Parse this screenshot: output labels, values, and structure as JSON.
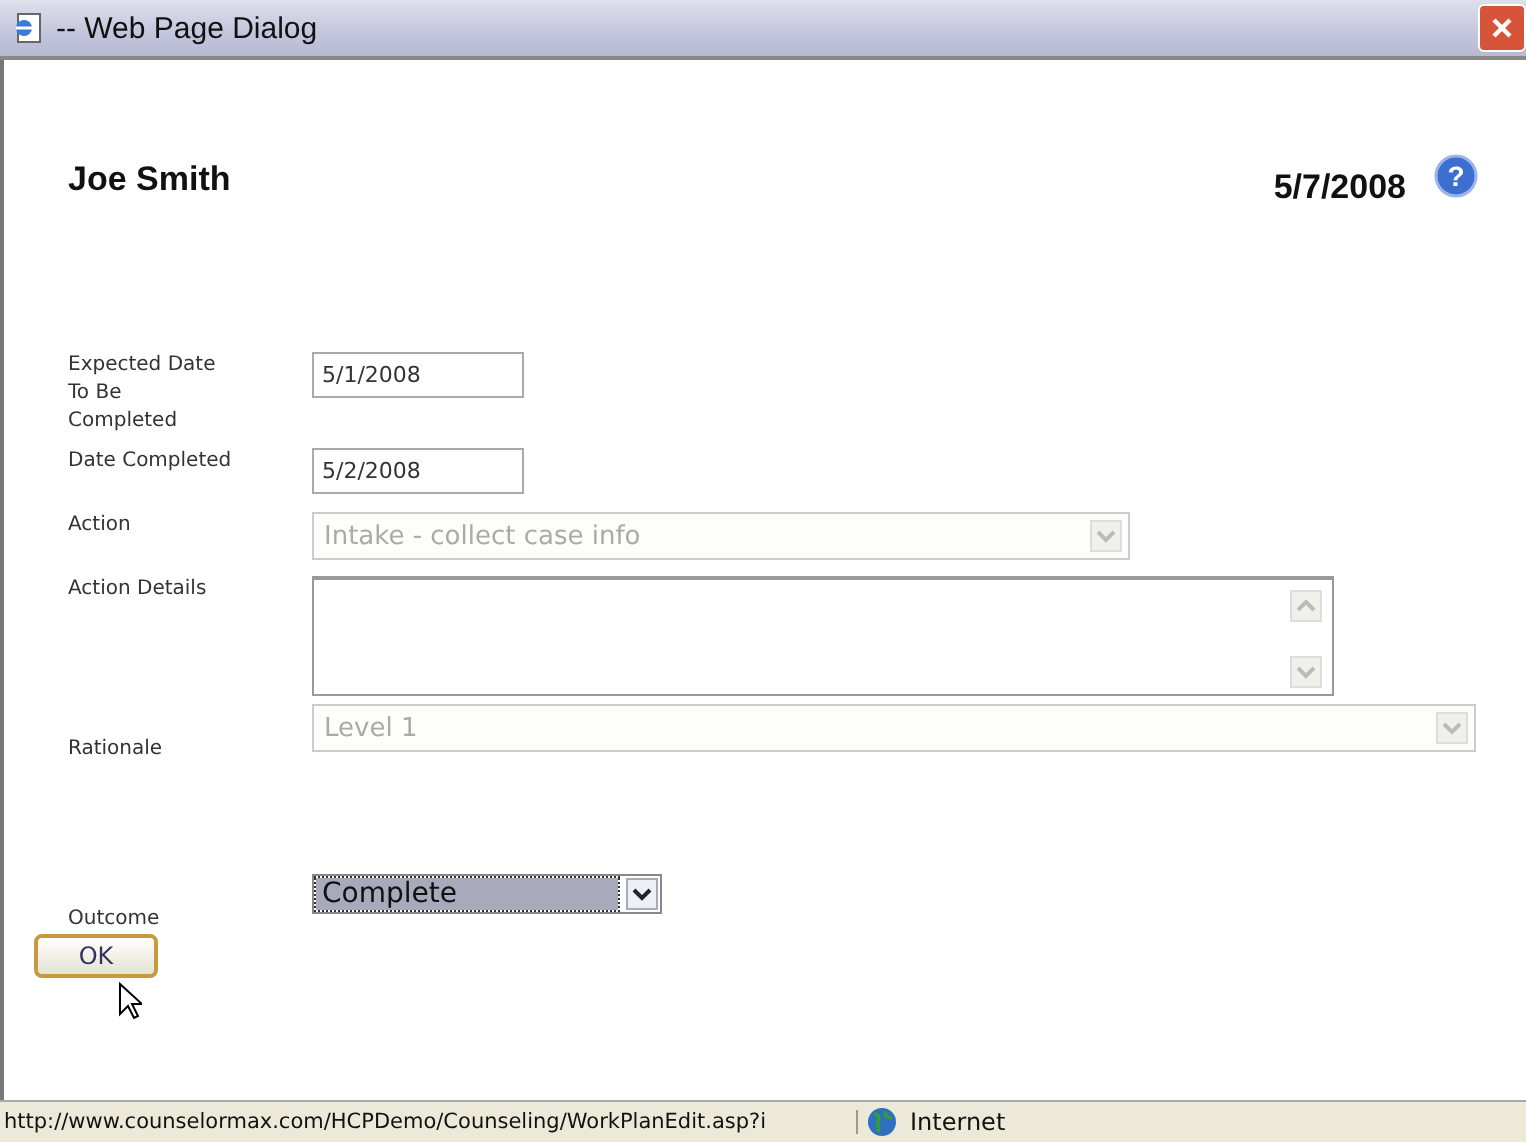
{
  "window": {
    "title": "-- Web Page Dialog"
  },
  "header": {
    "name": "Joe Smith",
    "date": "5/7/2008",
    "help": "?"
  },
  "fields": [
    {
      "kind": "text",
      "label": "Expected Date To Be Completed",
      "value": "5/1/2008",
      "disabled": false
    },
    {
      "kind": "text",
      "label": "Date Completed",
      "value": "5/2/2008",
      "disabled": false
    },
    {
      "kind": "select",
      "label": "Action",
      "value": "Intake - collect case info",
      "disabled": true
    },
    {
      "kind": "textarea",
      "label": "Action Details",
      "disabled": false
    },
    {
      "kind": "wideselect",
      "label": "Rationale",
      "value": "Level 1",
      "disabled": true
    },
    {
      "kind": "focusselect",
      "label": "Outcome",
      "value": "Complete",
      "disabled": false
    }
  ],
  "buttons": [
    "OK"
  ],
  "status_bar": {
    "url": "http://www.counselormax.com/HCPDemo/Counseling/WorkPlanEdit.asp?i",
    "zone": "Internet"
  }
}
